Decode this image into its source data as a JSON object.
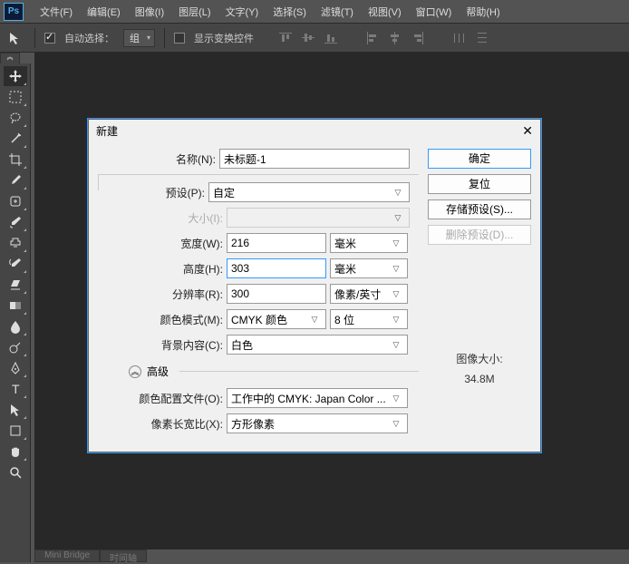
{
  "app": {
    "logo": "Ps"
  },
  "menu": {
    "file": "文件(F)",
    "edit": "编辑(E)",
    "image": "图像(I)",
    "layer": "图层(L)",
    "type": "文字(Y)",
    "select": "选择(S)",
    "filter": "滤镜(T)",
    "view": "视图(V)",
    "window": "窗口(W)",
    "help": "帮助(H)"
  },
  "options": {
    "auto_select": "自动选择：",
    "group": "组",
    "show_transform": "显示变换控件"
  },
  "bottom": {
    "mini_bridge": "Mini Bridge",
    "timeline": "时间轴"
  },
  "dialog": {
    "title": "新建",
    "name_lbl": "名称(N):",
    "name_val": "未标题-1",
    "preset_lbl": "预设(P):",
    "preset_val": "自定",
    "size_lbl": "大小(I):",
    "width_lbl": "宽度(W):",
    "width_val": "216",
    "width_unit": "毫米",
    "height_lbl": "高度(H):",
    "height_val": "303",
    "height_unit": "毫米",
    "res_lbl": "分辨率(R):",
    "res_val": "300",
    "res_unit": "像素/英寸",
    "mode_lbl": "颜色模式(M):",
    "mode_val": "CMYK 颜色",
    "depth_val": "8 位",
    "bg_lbl": "背景内容(C):",
    "bg_val": "白色",
    "adv": "高级",
    "profile_lbl": "颜色配置文件(O):",
    "profile_val": "工作中的 CMYK: Japan Color ...",
    "aspect_lbl": "像素长宽比(X):",
    "aspect_val": "方形像素",
    "ok": "确定",
    "reset": "复位",
    "save_preset": "存储预设(S)...",
    "delete_preset": "删除预设(D)...",
    "image_size_lbl": "图像大小:",
    "image_size_val": "34.8M"
  }
}
